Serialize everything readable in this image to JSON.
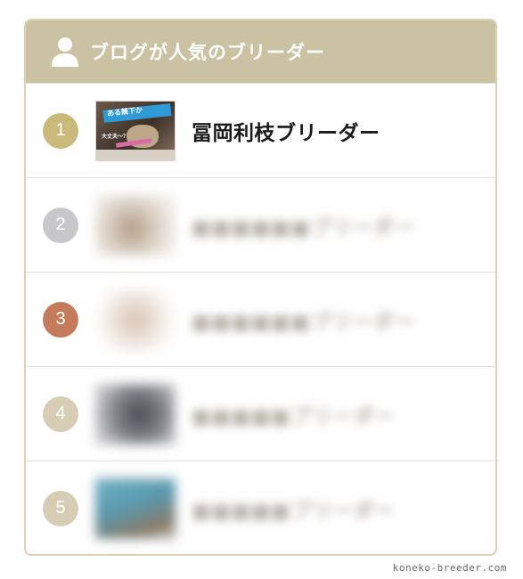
{
  "panel": {
    "title": "ブログが人気のブリーダー",
    "header_icon": "user-icon",
    "colors": {
      "header_bg": "#cbc2a3",
      "border": "#ddd2b6"
    }
  },
  "rankings": [
    {
      "rank": "1",
      "badge_color": "#c9b97a",
      "name": "冨岡利枝ブリーダー",
      "thumb_text": "ある競下か",
      "thumb_label": "大丈夫〜？",
      "blurred": false
    },
    {
      "rank": "2",
      "badge_color": "#c8c8cc",
      "name": "",
      "blurred": true
    },
    {
      "rank": "3",
      "badge_color": "#c47b5c",
      "name": "",
      "blurred": true
    },
    {
      "rank": "4",
      "badge_color": "#d6cdb4",
      "name": "",
      "blurred": true
    },
    {
      "rank": "5",
      "badge_color": "#d6cdb4",
      "name": "",
      "blurred": true
    }
  ],
  "watermark": "koneko-breeder.com"
}
